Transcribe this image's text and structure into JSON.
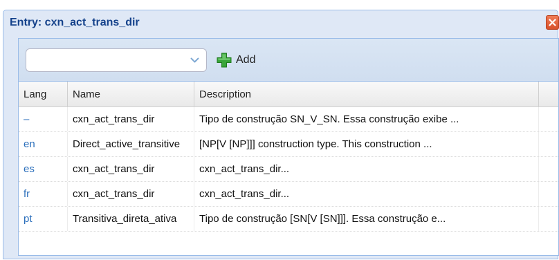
{
  "window": {
    "title": "Entry: cxn_act_trans_dir"
  },
  "toolbar": {
    "language_select_value": "",
    "add_label": "Add"
  },
  "grid": {
    "columns": [
      "Lang",
      "Name",
      "Description"
    ],
    "rows": [
      {
        "lang": "–",
        "name": "cxn_act_trans_dir",
        "description": "Tipo de construção SN_V_SN. Essa construção exibe ..."
      },
      {
        "lang": "en",
        "name": "Direct_active_transitive",
        "description": "[NP[V [NP]]] construction type. This construction ..."
      },
      {
        "lang": "es",
        "name": "cxn_act_trans_dir",
        "description": "cxn_act_trans_dir..."
      },
      {
        "lang": "fr",
        "name": "cxn_act_trans_dir",
        "description": "cxn_act_trans_dir..."
      },
      {
        "lang": "pt",
        "name": "Transitiva_direta_ativa",
        "description": "Tipo de construção [SN[V [SN]]]. Essa construção e..."
      }
    ]
  },
  "colors": {
    "title": "#15428b",
    "frame": "#dfe8f6",
    "border": "#99bbe8",
    "lang_link": "#2a6ebb",
    "close": "#d8502b",
    "add_icon": "#3aa53a"
  },
  "icons": {
    "close": "close-icon",
    "dropdown": "chevron-down-icon",
    "add": "plus-icon"
  }
}
